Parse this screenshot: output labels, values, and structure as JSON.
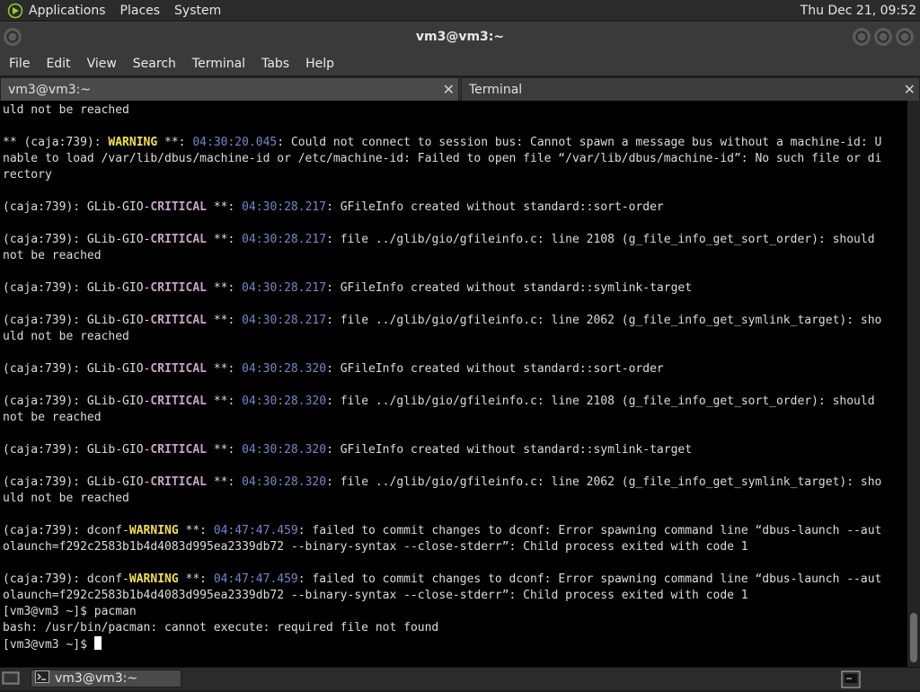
{
  "top_panel": {
    "menus": [
      "Applications",
      "Places",
      "System"
    ],
    "clock": "Thu Dec 21, 09:52"
  },
  "window": {
    "title": "vm3@vm3:~"
  },
  "menubar": {
    "items": [
      "File",
      "Edit",
      "View",
      "Search",
      "Terminal",
      "Tabs",
      "Help"
    ]
  },
  "tabs": [
    {
      "label": "vm3@vm3:~",
      "active": true
    },
    {
      "label": "Terminal",
      "active": false
    }
  ],
  "terminal": {
    "lines": [
      [
        {
          "t": "uld not be reached"
        }
      ],
      [],
      [
        {
          "t": "** (caja:739): "
        },
        {
          "t": "WARNING",
          "c": "warn"
        },
        {
          "t": " **: "
        },
        {
          "t": "04:30:20.045",
          "c": "time"
        },
        {
          "t": ": Could not connect to session bus: Cannot spawn a message bus without a machine-id: U"
        }
      ],
      [
        {
          "t": "nable to load /var/lib/dbus/machine-id or /etc/machine-id: Failed to open file “/var/lib/dbus/machine-id”: No such file or di"
        }
      ],
      [
        {
          "t": "rectory"
        }
      ],
      [],
      [
        {
          "t": "(caja:739): GLib-GIO-"
        },
        {
          "t": "CRITICAL",
          "c": "crit"
        },
        {
          "t": " **: "
        },
        {
          "t": "04:30:28.217",
          "c": "time"
        },
        {
          "t": ": GFileInfo created without standard::sort-order"
        }
      ],
      [],
      [
        {
          "t": "(caja:739): GLib-GIO-"
        },
        {
          "t": "CRITICAL",
          "c": "crit"
        },
        {
          "t": " **: "
        },
        {
          "t": "04:30:28.217",
          "c": "time"
        },
        {
          "t": ": file ../glib/gio/gfileinfo.c: line 2108 (g_file_info_get_sort_order): should"
        }
      ],
      [
        {
          "t": "not be reached"
        }
      ],
      [],
      [
        {
          "t": "(caja:739): GLib-GIO-"
        },
        {
          "t": "CRITICAL",
          "c": "crit"
        },
        {
          "t": " **: "
        },
        {
          "t": "04:30:28.217",
          "c": "time"
        },
        {
          "t": ": GFileInfo created without standard::symlink-target"
        }
      ],
      [],
      [
        {
          "t": "(caja:739): GLib-GIO-"
        },
        {
          "t": "CRITICAL",
          "c": "crit"
        },
        {
          "t": " **: "
        },
        {
          "t": "04:30:28.217",
          "c": "time"
        },
        {
          "t": ": file ../glib/gio/gfileinfo.c: line 2062 (g_file_info_get_symlink_target): sho"
        }
      ],
      [
        {
          "t": "uld not be reached"
        }
      ],
      [],
      [
        {
          "t": "(caja:739): GLib-GIO-"
        },
        {
          "t": "CRITICAL",
          "c": "crit"
        },
        {
          "t": " **: "
        },
        {
          "t": "04:30:28.320",
          "c": "time"
        },
        {
          "t": ": GFileInfo created without standard::sort-order"
        }
      ],
      [],
      [
        {
          "t": "(caja:739): GLib-GIO-"
        },
        {
          "t": "CRITICAL",
          "c": "crit"
        },
        {
          "t": " **: "
        },
        {
          "t": "04:30:28.320",
          "c": "time"
        },
        {
          "t": ": file ../glib/gio/gfileinfo.c: line 2108 (g_file_info_get_sort_order): should"
        }
      ],
      [
        {
          "t": "not be reached"
        }
      ],
      [],
      [
        {
          "t": "(caja:739): GLib-GIO-"
        },
        {
          "t": "CRITICAL",
          "c": "crit"
        },
        {
          "t": " **: "
        },
        {
          "t": "04:30:28.320",
          "c": "time"
        },
        {
          "t": ": GFileInfo created without standard::symlink-target"
        }
      ],
      [],
      [
        {
          "t": "(caja:739): GLib-GIO-"
        },
        {
          "t": "CRITICAL",
          "c": "crit"
        },
        {
          "t": " **: "
        },
        {
          "t": "04:30:28.320",
          "c": "time"
        },
        {
          "t": ": file ../glib/gio/gfileinfo.c: line 2062 (g_file_info_get_symlink_target): sho"
        }
      ],
      [
        {
          "t": "uld not be reached"
        }
      ],
      [],
      [
        {
          "t": "(caja:739): dconf-"
        },
        {
          "t": "WARNING",
          "c": "warn"
        },
        {
          "t": " **: "
        },
        {
          "t": "04:47:47.459",
          "c": "time"
        },
        {
          "t": ": failed to commit changes to dconf: Error spawning command line “dbus-launch --aut"
        }
      ],
      [
        {
          "t": "olaunch=f292c2583b1b4d4083d995ea2339db72 --binary-syntax --close-stderr”: Child process exited with code 1"
        }
      ],
      [],
      [
        {
          "t": "(caja:739): dconf-"
        },
        {
          "t": "WARNING",
          "c": "warn"
        },
        {
          "t": " **: "
        },
        {
          "t": "04:47:47.459",
          "c": "time"
        },
        {
          "t": ": failed to commit changes to dconf: Error spawning command line “dbus-launch --aut"
        }
      ],
      [
        {
          "t": "olaunch=f292c2583b1b4d4083d995ea2339db72 --binary-syntax --close-stderr”: Child process exited with code 1"
        }
      ],
      [
        {
          "t": "[vm3@vm3 ~]$ pacman"
        }
      ],
      [
        {
          "t": "bash: /usr/bin/pacman: cannot execute: required file not found"
        }
      ],
      [
        {
          "t": "[vm3@vm3 ~]$ "
        }
      ]
    ],
    "colors": {
      "warning": "#f0e050",
      "critical": "#c9a3c8",
      "timestamp": "#6f88c8",
      "text": "#dcdcdc"
    }
  },
  "taskbar": {
    "items": [
      {
        "label": "vm3@vm3:~"
      }
    ]
  },
  "icons": {
    "panel_logo": "app-menu-icon",
    "show_desktop": "show-desktop-icon",
    "taskbar_app": "terminal-icon",
    "tray": "terminal-icon"
  }
}
